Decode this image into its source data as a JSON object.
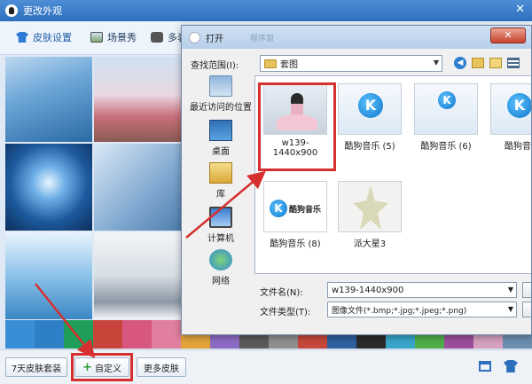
{
  "window": {
    "title": "更改外观",
    "close": "✕"
  },
  "toolbar": {
    "skin_settings": "皮肤设置",
    "scene_show": "场景秀",
    "more_label": "多表"
  },
  "bottom": {
    "seven_day": "7天皮肤套装",
    "custom": "自定义",
    "more_skins": "更多皮肤"
  },
  "dialog": {
    "title": "打开",
    "title_ghost": "程序窗",
    "look_in_label": "查找范围(I):",
    "look_in_value": "套图",
    "places": [
      {
        "label": "最近访问的位置",
        "icon": "recent-places-icon"
      },
      {
        "label": "桌面",
        "icon": "desktop-icon"
      },
      {
        "label": "库",
        "icon": "library-icon"
      },
      {
        "label": "计算机",
        "icon": "computer-icon"
      },
      {
        "label": "网络",
        "icon": "network-icon"
      }
    ],
    "files": [
      {
        "name": "w139-1440x900"
      },
      {
        "name": "酷狗音乐 (5)"
      },
      {
        "name": "酷狗音乐 (6)"
      },
      {
        "name": "酷狗音乐"
      },
      {
        "name": "酷狗音乐 (8)"
      },
      {
        "name": "派大星3"
      }
    ],
    "kugou_logo_text": "酷狗音乐",
    "kugou_k": "K",
    "filename_label": "文件名(N):",
    "filename_value": "w139-1440x900",
    "filetype_label": "文件类型(T):",
    "filetype_value": "图像文件(*.bmp;*.jpg;*.jpeg;*.png)"
  },
  "colors": {
    "accent": "#2e6fbd",
    "highlight": "#d62f2f"
  }
}
